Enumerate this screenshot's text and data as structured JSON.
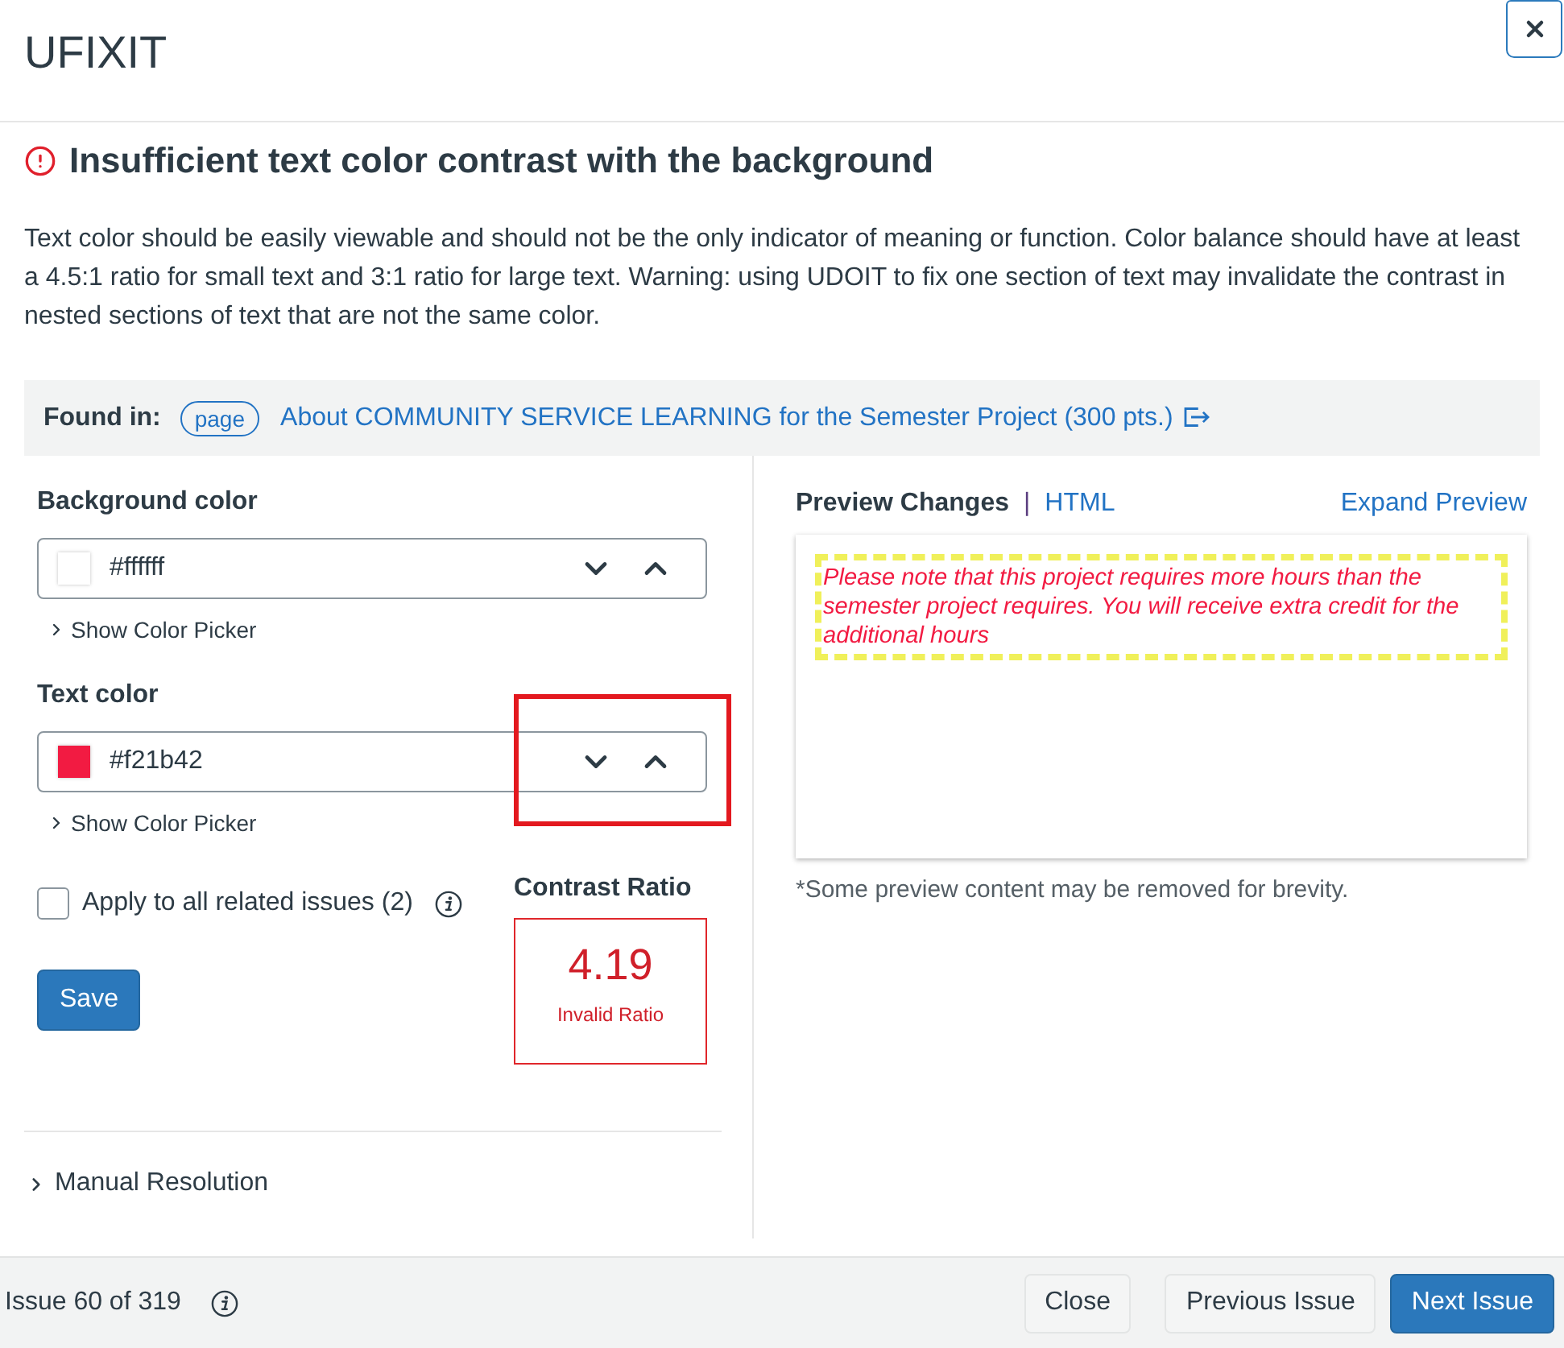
{
  "window": {
    "title": "UFIXIT"
  },
  "issue": {
    "title": "Insufficient text color contrast with the background",
    "description": "Text color should be easily viewable and should not be the only indicator of meaning or function. Color balance should have at least a 4.5:1 ratio for small text and 3:1 ratio for large text. Warning: using UDOIT to fix one section of text may invalidate the contrast in nested sections of text that are not the same color."
  },
  "found_in": {
    "label": "Found in:",
    "type_badge": "page",
    "link": "About COMMUNITY SERVICE LEARNING for the Semester Project (300 pts.)"
  },
  "color_fields": [
    {
      "label": "Background color",
      "value": "#ffffff",
      "color": "#ffffff",
      "picker_label": "Show Color Picker",
      "picker_expanded": false,
      "highlighted": false
    },
    {
      "label": "Text color",
      "value": "#f21b42",
      "color": "#f21b42",
      "picker_label": "Show Color Picker",
      "picker_expanded": false,
      "highlighted": true
    }
  ],
  "apply_all": {
    "label": "Apply to all related issues (2)",
    "checked": false
  },
  "save_button": "Save",
  "contrast": {
    "heading": "Contrast Ratio",
    "value": "4.19",
    "status": "Invalid Ratio",
    "valid": false
  },
  "manual_resolution": {
    "label": "Manual Resolution",
    "expanded": false
  },
  "preview": {
    "tabs": [
      {
        "label": "Preview Changes",
        "selected": true
      },
      {
        "label": "HTML",
        "selected": false
      }
    ],
    "separator": "|",
    "expand_link": "Expand Preview",
    "content": "Please note that this project requires more hours than the semester project requires. You will receive extra credit for the additional hours",
    "note": "*Some preview content may be removed for brevity."
  },
  "footer": {
    "counter": "Issue 60 of 319",
    "buttons": [
      {
        "label": "Close",
        "kind": "secondary"
      },
      {
        "label": "Previous Issue",
        "kind": "secondary"
      },
      {
        "label": "Next Issue",
        "kind": "primary"
      }
    ]
  }
}
